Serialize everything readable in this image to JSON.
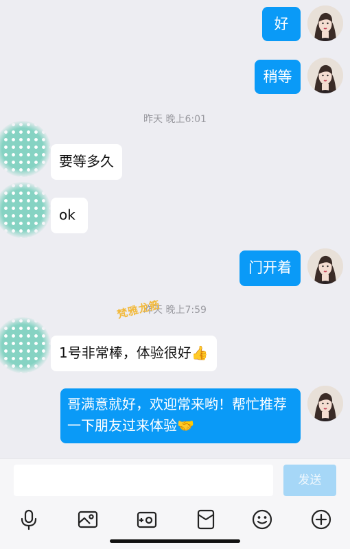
{
  "colors": {
    "my_bubble": "#0a9af7",
    "other_bubble": "#ffffff",
    "background": "#ededf2",
    "send_disabled": "#a6d7f7",
    "watermark": "#f2b93b"
  },
  "messages": [
    {
      "sender": "me",
      "text": "好"
    },
    {
      "sender": "me",
      "text": "稍等"
    },
    {
      "type": "timestamp",
      "text": "昨天 晚上6:01"
    },
    {
      "sender": "other",
      "text": "要等多久"
    },
    {
      "sender": "other",
      "text": "ok"
    },
    {
      "sender": "me",
      "text": "门开着"
    },
    {
      "type": "timestamp",
      "text": "昨天 晚上7:59"
    },
    {
      "sender": "other",
      "text": "1号非常棒，体验很好👍"
    },
    {
      "sender": "me",
      "text": "哥满意就好，欢迎常来哟！帮忙推荐一下朋友过来体验🤝"
    }
  ],
  "watermark": "梵雅龙筋",
  "composer": {
    "input_value": "",
    "send_label": "发送",
    "send_enabled": false
  },
  "toolbar": {
    "icons": [
      "microphone-icon",
      "image-icon",
      "camera-icon",
      "red-packet-icon",
      "emoji-icon",
      "plus-icon"
    ]
  }
}
